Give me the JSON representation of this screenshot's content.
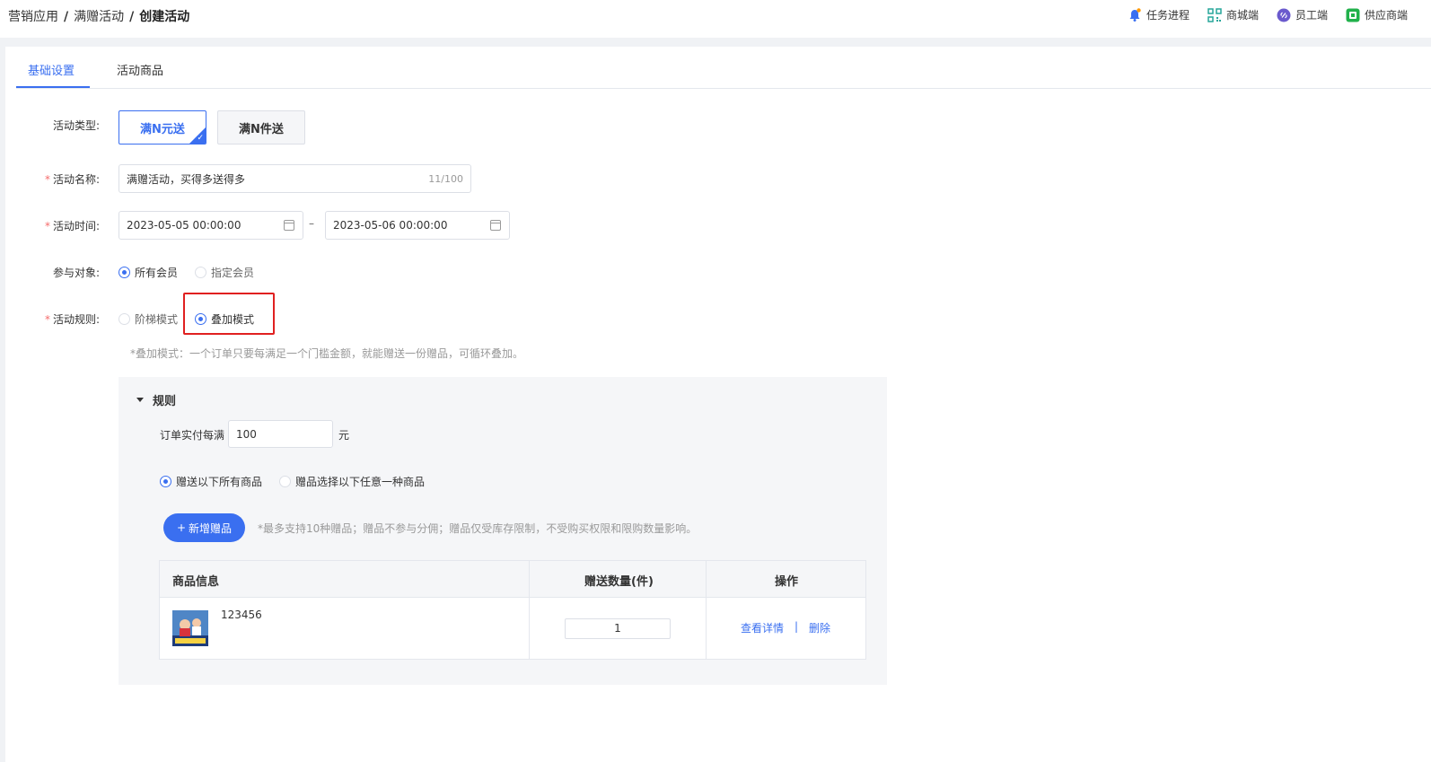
{
  "breadcrumb": {
    "items": [
      "营销应用",
      "满赠活动"
    ],
    "current": "创建活动",
    "separator": "/"
  },
  "toplinks": [
    {
      "label": "任务进程",
      "icon": "bell-icon",
      "color": "#3a6ff0"
    },
    {
      "label": "商城端",
      "icon": "qrcode-icon",
      "color": "#26a69a"
    },
    {
      "label": "员工端",
      "icon": "link-icon",
      "color": "#6a5acd"
    },
    {
      "label": "供应商端",
      "icon": "supplier-icon",
      "color": "#21b14b"
    }
  ],
  "tabs": [
    {
      "label": "基础设置",
      "active": true
    },
    {
      "label": "活动商品",
      "active": false
    }
  ],
  "form": {
    "type_label": "活动类型:",
    "type_options": [
      "满N元送",
      "满N件送"
    ],
    "name_label": "活动名称:",
    "name_value": "满赠活动，买得多送得多",
    "name_count": "11/100",
    "time_label": "活动时间:",
    "time_start": "2023-05-05 00:00:00",
    "time_end": "2023-05-06 00:00:00",
    "time_sep": "–",
    "target_label": "参与对象:",
    "target_options": [
      "所有会员",
      "指定会员"
    ],
    "rule_label": "活动规则:",
    "rule_options": [
      "阶梯模式",
      "叠加模式"
    ],
    "rule_tip": "*叠加模式：一个订单只要每满足一个门槛金额，就能赠送一份赠品，可循环叠加。",
    "required_mark": "*"
  },
  "rules": {
    "title": "规则",
    "threshold_prefix": "订单实付每满",
    "threshold_value": "100",
    "threshold_unit": "元",
    "gift_options": [
      "赠送以下所有商品",
      "赠品选择以下任意一种商品"
    ],
    "add_button": "新增赠品",
    "add_icon": "+",
    "add_tip": "*最多支持10种赠品；赠品不参与分佣；赠品仅受库存限制，不受购买权限和限购数量影响。",
    "table": {
      "headers": [
        "商品信息",
        "赠送数量(件)",
        "操作"
      ],
      "rows": [
        {
          "name": "123456",
          "qty": "1",
          "ops": [
            "查看详情",
            "删除"
          ]
        }
      ],
      "op_separator": "|"
    }
  }
}
